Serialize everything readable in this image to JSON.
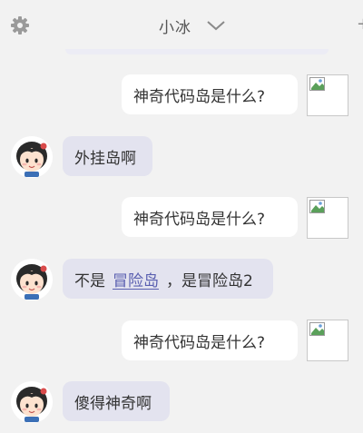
{
  "header": {
    "title": "小冰",
    "edge_glyph": "+"
  },
  "messages": [
    {
      "side": "right",
      "text": "神奇代码岛是什么?"
    },
    {
      "side": "left",
      "text": "外挂岛啊"
    },
    {
      "side": "right",
      "text": "神奇代码岛是什么?"
    },
    {
      "side": "left",
      "prefix": "不是",
      "link": "冒险岛",
      "suffix": "，是冒险岛2"
    },
    {
      "side": "right",
      "text": "神奇代码岛是什么?"
    },
    {
      "side": "left",
      "text": "傻得神奇啊"
    }
  ],
  "colors": {
    "background": "#f2f2f2",
    "user_bubble": "#ffffff",
    "bot_bubble": "#e3e3ef",
    "link": "#5a5fb0"
  },
  "icons": {
    "settings": "gear-icon",
    "title_dropdown": "chevron-down-icon",
    "user_avatar": "broken-image-icon",
    "bot_avatar": "girl-avatar-icon"
  }
}
